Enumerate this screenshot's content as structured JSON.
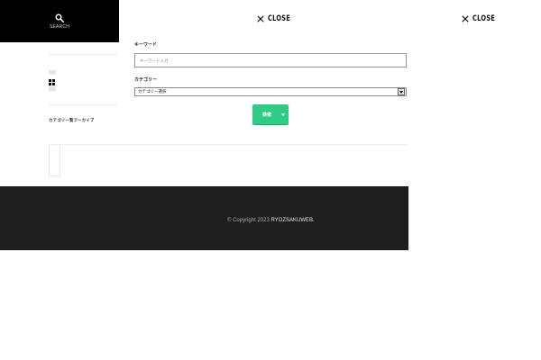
{
  "search": {
    "label": "SEARCH"
  },
  "close_buttons": [
    {
      "label": "CLOSE"
    },
    {
      "label": "CLOSE"
    }
  ],
  "sidebar": {
    "text": "カテゴリ一覧アーカイブ"
  },
  "form": {
    "field1_label": "キーワード",
    "field1_placeholder": "キーワード入力",
    "field2_label": "カテゴリー",
    "field2_value": "カテゴリー選択",
    "submit_label": "検索"
  },
  "footer": {
    "copyright_prefix": "© Copyright 2023",
    "site_name": "RYOZSAKUWEB."
  },
  "colors": {
    "accent": "#2ecc86",
    "footer_bg": "#1e1e1e",
    "search_bg": "#000000"
  }
}
